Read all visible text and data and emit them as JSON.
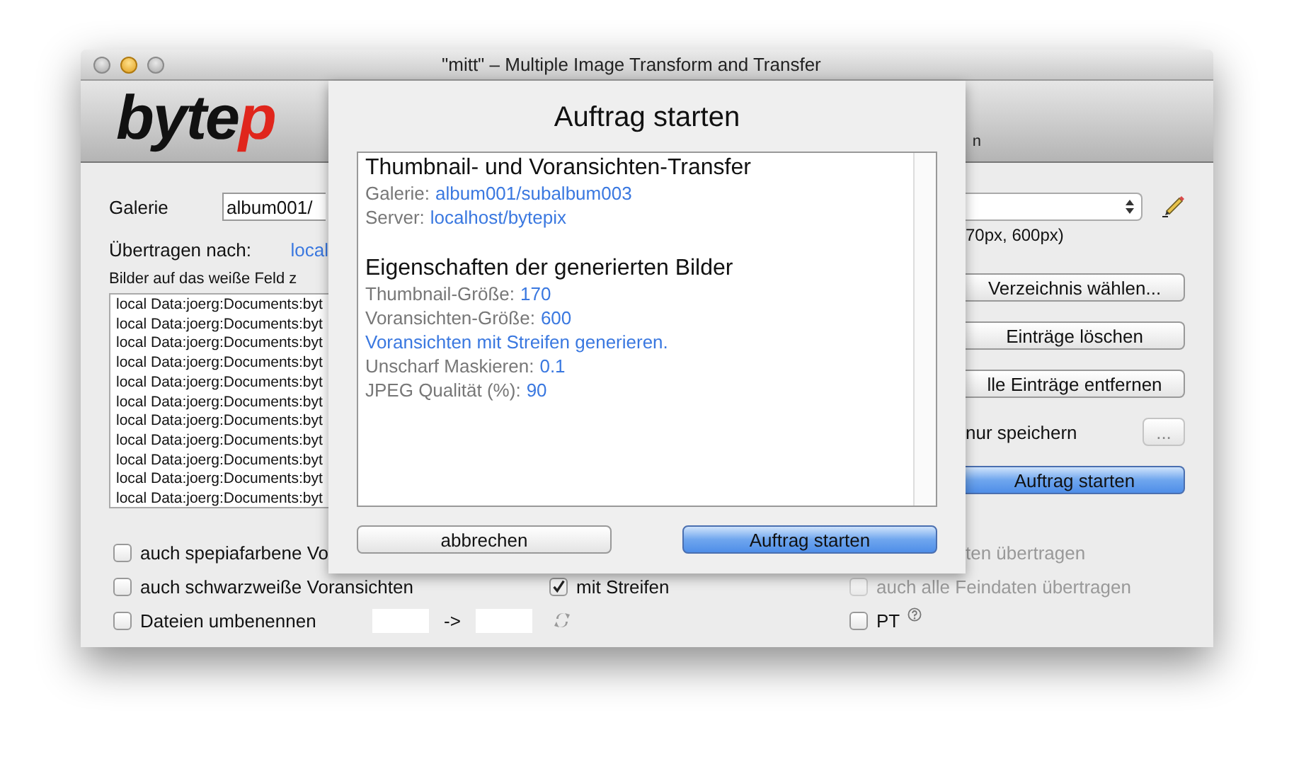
{
  "window": {
    "title": "\"mitt\" – Multiple Image Transform and Transfer"
  },
  "toolbar": {
    "logo": {
      "text": "byte",
      "accent": "p"
    },
    "labels": [
      "n"
    ]
  },
  "form": {
    "gallery": {
      "label": "Galerie",
      "value": "album001/"
    },
    "target": {
      "label": "Übertragen nach:",
      "link": "local"
    },
    "drop_hint": "Bilder auf das weiße Feld z",
    "files": [
      "local Data:joerg:Documents:byt",
      "local Data:joerg:Documents:byt",
      "local Data:joerg:Documents:byt",
      "local Data:joerg:Documents:byt",
      "local Data:joerg:Documents:byt",
      "local Data:joerg:Documents:byt",
      "local Data:joerg:Documents:byt",
      "local Data:joerg:Documents:byt",
      "local Data:joerg:Documents:byt",
      "local Data:joerg:Documents:byt",
      "local Data:joerg:Documents:byt"
    ]
  },
  "right_panel": {
    "size_note": "70px, 600px)",
    "items": [
      {
        "kind": "button",
        "label": "Verzeichnis wählen..."
      },
      {
        "kind": "button",
        "label": "Einträge löschen"
      },
      {
        "kind": "button",
        "label": "lle Einträge entfernen"
      },
      {
        "kind": "save",
        "label": "nur speichern",
        "button": "..."
      },
      {
        "kind": "primary",
        "label": "Auftrag starten"
      }
    ]
  },
  "options_left": [
    {
      "kind": "checkbox",
      "label": "auch spepiafarbene Vo",
      "checked": false
    },
    {
      "kind": "checkbox",
      "label": "auch schwarzweiße Voransichten",
      "checked": false
    },
    {
      "kind": "rename",
      "label": "Dateien umbenennen",
      "checked": false,
      "arrow": "->"
    }
  ],
  "options_mid": [
    {
      "label": "mit Streifen",
      "checked": true
    }
  ],
  "options_right": [
    {
      "kind": "text",
      "label": "ten übertragen",
      "disabled": true
    },
    {
      "kind": "checkbox",
      "label": "auch alle Feindaten übertragen",
      "checked": false,
      "disabled": true
    },
    {
      "kind": "help",
      "label": "PT",
      "checked": false,
      "disabled": false
    }
  ],
  "sheet": {
    "title": "Auftrag starten",
    "sections": [
      {
        "heading": "Thumbnail- und Voransichten-Transfer",
        "lines": [
          {
            "kind": "pair",
            "label": "Galerie:",
            "value": "album001/subalbum003"
          },
          {
            "kind": "pair",
            "label": "Server:",
            "value": "localhost/bytepix"
          }
        ]
      },
      {
        "heading": "Eigenschaften der generierten Bilder",
        "lines": [
          {
            "kind": "pair",
            "label": "Thumbnail-Größe:",
            "value": "170"
          },
          {
            "kind": "pair",
            "label": "Voransichten-Größe:",
            "value": "600"
          },
          {
            "kind": "note",
            "text": "Voransichten mit Streifen generieren."
          },
          {
            "kind": "pair",
            "label": "Unscharf Maskieren:",
            "value": "0.1"
          },
          {
            "kind": "pair",
            "label": "JPEG Qualität (%):",
            "value": "90"
          }
        ]
      }
    ],
    "buttons": [
      {
        "label": "abbrechen",
        "primary": false
      },
      {
        "label": "Auftrag starten",
        "primary": true
      }
    ]
  }
}
